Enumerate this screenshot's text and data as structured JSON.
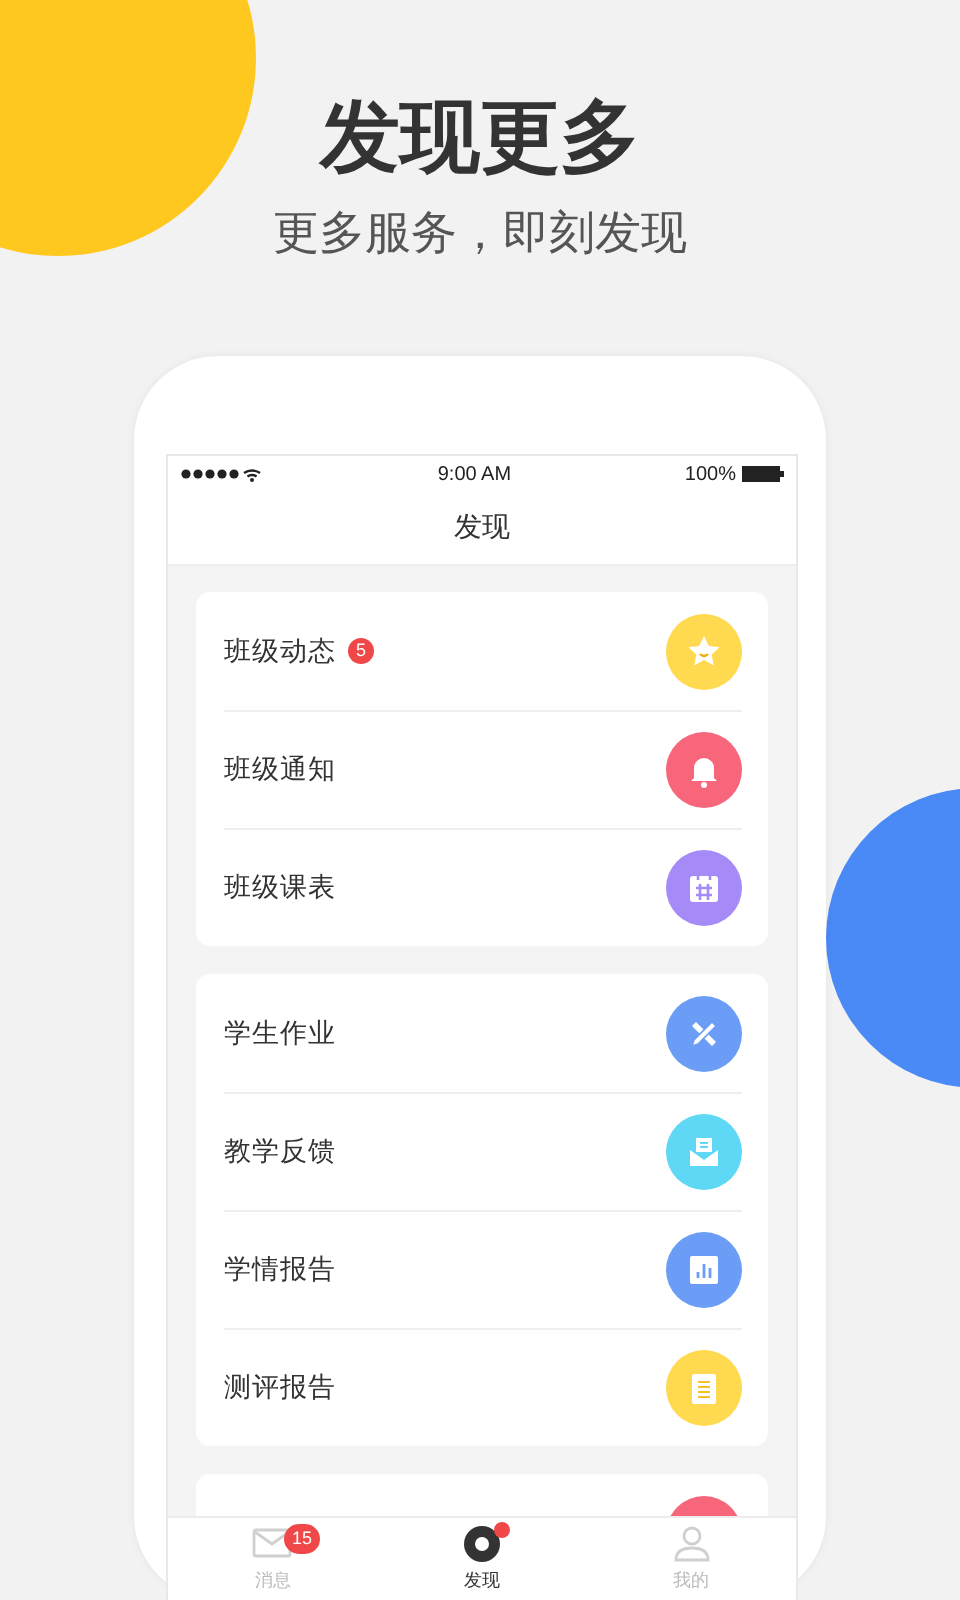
{
  "headline": "发现更多",
  "subheadline": "更多服务，即刻发现",
  "status_bar": {
    "time": "9:00 AM",
    "battery": "100%"
  },
  "nav": {
    "title": "发现"
  },
  "groups": [
    {
      "items": [
        {
          "label": "班级动态",
          "badge": "5",
          "color": "#ffd94f"
        },
        {
          "label": "班级通知",
          "color": "#f7667a"
        },
        {
          "label": "班级课表",
          "color": "#a58af8"
        }
      ]
    },
    {
      "items": [
        {
          "label": "学生作业",
          "color": "#6b9cf6"
        },
        {
          "label": "教学反馈",
          "color": "#5ed8f4"
        },
        {
          "label": "学情报告",
          "color": "#6b9cf6"
        },
        {
          "label": "测评报告",
          "color": "#ffd94f"
        }
      ]
    },
    {
      "items": [
        {
          "color": "#f7667a"
        }
      ]
    }
  ],
  "tabs": [
    {
      "label": "消息",
      "badge": "15",
      "dot": false,
      "selected": false
    },
    {
      "label": "发现",
      "dot": true,
      "selected": true
    },
    {
      "label": "我的",
      "dot": false,
      "selected": false
    }
  ]
}
